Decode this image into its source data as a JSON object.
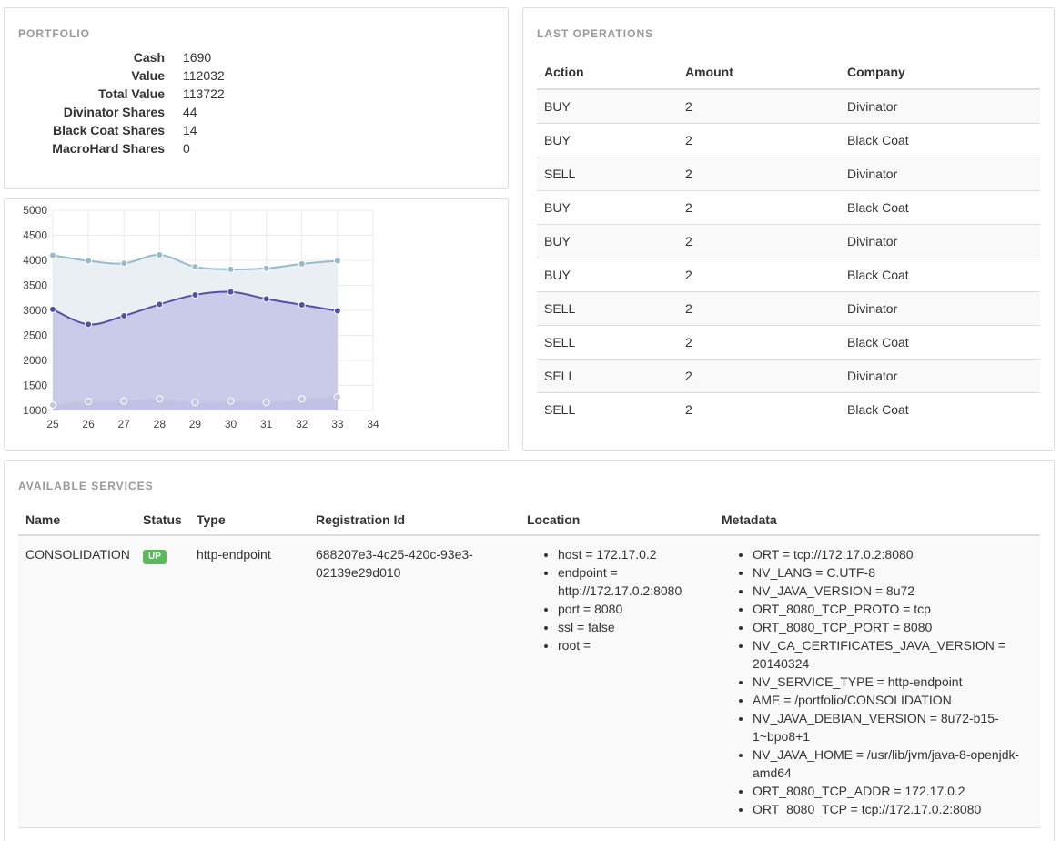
{
  "portfolio": {
    "title": "PORTFOLIO",
    "rows": [
      {
        "key": "Cash",
        "value": "1690"
      },
      {
        "key": "Value",
        "value": "112032"
      },
      {
        "key": "Total Value",
        "value": "113722"
      },
      {
        "key": "Divinator Shares",
        "value": "44"
      },
      {
        "key": "Black Coat Shares",
        "value": "14"
      },
      {
        "key": "MacroHard Shares",
        "value": "0"
      }
    ]
  },
  "chart_data": {
    "type": "area",
    "x": [
      25,
      26,
      27,
      28,
      29,
      30,
      31,
      32,
      33
    ],
    "xticks": [
      25,
      26,
      27,
      28,
      29,
      30,
      31,
      32,
      33,
      34
    ],
    "yticks": [
      1000,
      1500,
      2000,
      2500,
      3000,
      3500,
      4000,
      4500,
      5000
    ],
    "xlim": [
      25,
      34
    ],
    "ylim": [
      1000,
      5000
    ],
    "grid": true,
    "series": [
      {
        "values": [
          4100,
          3990,
          3940,
          4110,
          3870,
          3820,
          3840,
          3930,
          3990
        ],
        "color": "#97bbcd",
        "fill": "#eaeff3"
      },
      {
        "values": [
          3020,
          2720,
          2890,
          3120,
          3310,
          3370,
          3230,
          3110,
          2990
        ],
        "color": "#5350a8",
        "fill": "#c9cbe9"
      },
      {
        "values": [
          1110,
          1180,
          1190,
          1230,
          1160,
          1190,
          1160,
          1230,
          1270
        ],
        "color": "#c5c7e1",
        "fill": "#c0c2e5"
      }
    ]
  },
  "operations": {
    "title": "LAST OPERATIONS",
    "columns": [
      "Action",
      "Amount",
      "Company"
    ],
    "rows": [
      [
        "BUY",
        "2",
        "Divinator"
      ],
      [
        "BUY",
        "2",
        "Black Coat"
      ],
      [
        "SELL",
        "2",
        "Divinator"
      ],
      [
        "BUY",
        "2",
        "Black Coat"
      ],
      [
        "BUY",
        "2",
        "Divinator"
      ],
      [
        "BUY",
        "2",
        "Black Coat"
      ],
      [
        "SELL",
        "2",
        "Divinator"
      ],
      [
        "SELL",
        "2",
        "Black Coat"
      ],
      [
        "SELL",
        "2",
        "Divinator"
      ],
      [
        "SELL",
        "2",
        "Black Coat"
      ]
    ]
  },
  "services": {
    "title": "AVAILABLE SERVICES",
    "columns": [
      "Name",
      "Status",
      "Type",
      "Registration Id",
      "Location",
      "Metadata"
    ],
    "rows": [
      {
        "name": "CONSOLIDATION",
        "status": "UP",
        "type": "http-endpoint",
        "registration_id": "688207e3-4c25-420c-93e3-02139e29d010",
        "location": [
          "host = 172.17.0.2",
          "endpoint = http://172.17.0.2:8080",
          "port = 8080",
          "ssl = false",
          "root ="
        ],
        "metadata": [
          "ORT = tcp://172.17.0.2:8080",
          "NV_LANG = C.UTF-8",
          "NV_JAVA_VERSION = 8u72",
          "ORT_8080_TCP_PROTO = tcp",
          "ORT_8080_TCP_PORT = 8080",
          "NV_CA_CERTIFICATES_JAVA_VERSION = 20140324",
          "NV_SERVICE_TYPE = http-endpoint",
          "AME = /portfolio/CONSOLIDATION",
          "NV_JAVA_DEBIAN_VERSION = 8u72-b15-1~bpo8+1",
          "NV_JAVA_HOME = /usr/lib/jvm/java-8-openjdk-amd64",
          "ORT_8080_TCP_ADDR = 172.17.0.2",
          "ORT_8080_TCP = tcp://172.17.0.2:8080"
        ]
      }
    ]
  },
  "colors": {
    "status_up": "#5cb85c",
    "border": "#dddddd",
    "title": "#999999"
  }
}
